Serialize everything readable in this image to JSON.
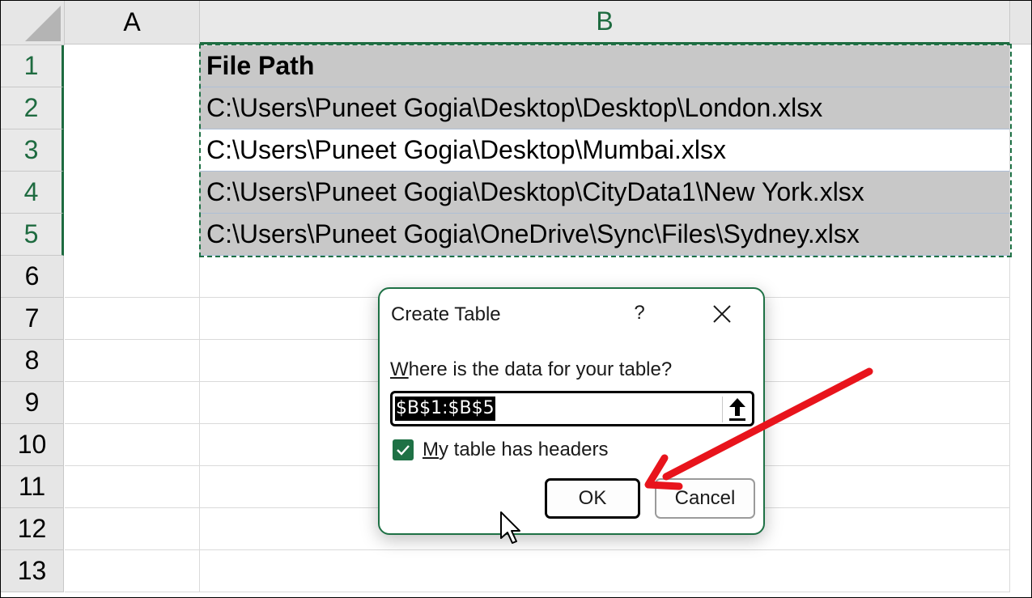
{
  "columns": [
    "A",
    "B"
  ],
  "rows": [
    "1",
    "2",
    "3",
    "4",
    "5",
    "6",
    "7",
    "8",
    "9",
    "10",
    "11",
    "12",
    "13"
  ],
  "cells": {
    "b1": "File Path",
    "b2": "C:\\Users\\Puneet Gogia\\Desktop\\Desktop\\London.xlsx",
    "b3": "C:\\Users\\Puneet Gogia\\Desktop\\Mumbai.xlsx",
    "b4": "C:\\Users\\Puneet Gogia\\Desktop\\CityData1\\New York.xlsx",
    "b5": "C:\\Users\\Puneet Gogia\\OneDrive\\Sync\\Files\\Sydney.xlsx"
  },
  "dialog": {
    "title": "Create Table",
    "help": "?",
    "prompt_underlined": "W",
    "prompt_rest": "here is the data for your table?",
    "range_value": "$B$1:$B$5",
    "checkbox_underlined": "M",
    "checkbox_rest": "y table has headers",
    "checkbox_checked": true,
    "ok_label": "OK",
    "cancel_label": "Cancel"
  },
  "colors": {
    "accent_green": "#1e7145",
    "selection_fill": "#c8c8c8",
    "annotation_red": "#e8141c"
  },
  "icons": {
    "close": "close-icon",
    "range_collapse": "upload-arrow-icon",
    "checkbox": "checkmark-icon",
    "annotation": "red-arrow-icon",
    "pointer": "mouse-cursor-icon"
  }
}
